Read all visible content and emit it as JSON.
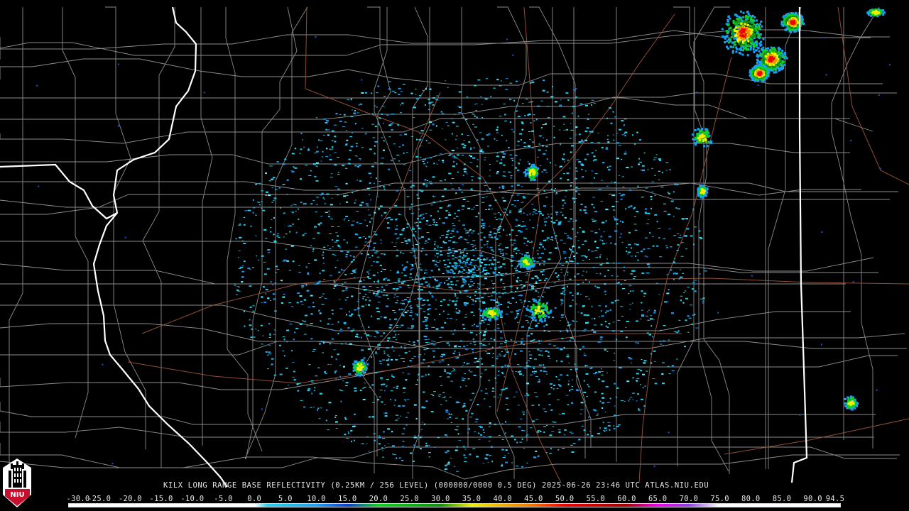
{
  "caption": {
    "product_text": "KILX LONG RANGE BASE REFLECTIVITY (0.25KM / 256 LEVEL) (000000/0000 0.5 DEG) 2025-06-26 23:46 UTC  ATLAS.NIU.EDU"
  },
  "logo": {
    "text": "NIU",
    "background_color": "#c8102e",
    "icon": "university-tower-icon"
  },
  "color_scale": {
    "labels": [
      "-30.0",
      "-25.0",
      "-20.0",
      "-15.0",
      "-10.0",
      "-5.0",
      "0.0",
      "5.0",
      "10.0",
      "15.0",
      "20.0",
      "25.0",
      "30.0",
      "35.0",
      "40.0",
      "45.0",
      "50.0",
      "55.0",
      "60.0",
      "65.0",
      "70.0",
      "75.0",
      "80.0",
      "85.0",
      "90.0",
      "94.5"
    ],
    "values": [
      -30,
      -25,
      -20,
      -15,
      -10,
      -5,
      0,
      5,
      10,
      15,
      20,
      25,
      30,
      35,
      40,
      45,
      50,
      55,
      60,
      65,
      70,
      75,
      80,
      85,
      90,
      94.5
    ],
    "stops": [
      {
        "value": -30,
        "color": "#ffffff"
      },
      {
        "value": 0,
        "color": "#ffffff"
      },
      {
        "value": 2,
        "color": "#2ad0e8"
      },
      {
        "value": 10,
        "color": "#1ea0f0"
      },
      {
        "value": 15,
        "color": "#1040d0"
      },
      {
        "value": 20,
        "color": "#10d020"
      },
      {
        "value": 30,
        "color": "#109010"
      },
      {
        "value": 35,
        "color": "#f0f000"
      },
      {
        "value": 40,
        "color": "#f0b000"
      },
      {
        "value": 45,
        "color": "#f07000"
      },
      {
        "value": 50,
        "color": "#f00000"
      },
      {
        "value": 60,
        "color": "#a00000"
      },
      {
        "value": 65,
        "color": "#f000f0"
      },
      {
        "value": 70,
        "color": "#9040e0"
      },
      {
        "value": 75,
        "color": "#ffffff"
      },
      {
        "value": 94.5,
        "color": "#ffffff"
      }
    ]
  },
  "map_colors": {
    "background": "#000000",
    "state_border": "#ffffff",
    "county_border": "#8c8c8c",
    "highway": "#b0603a"
  }
}
